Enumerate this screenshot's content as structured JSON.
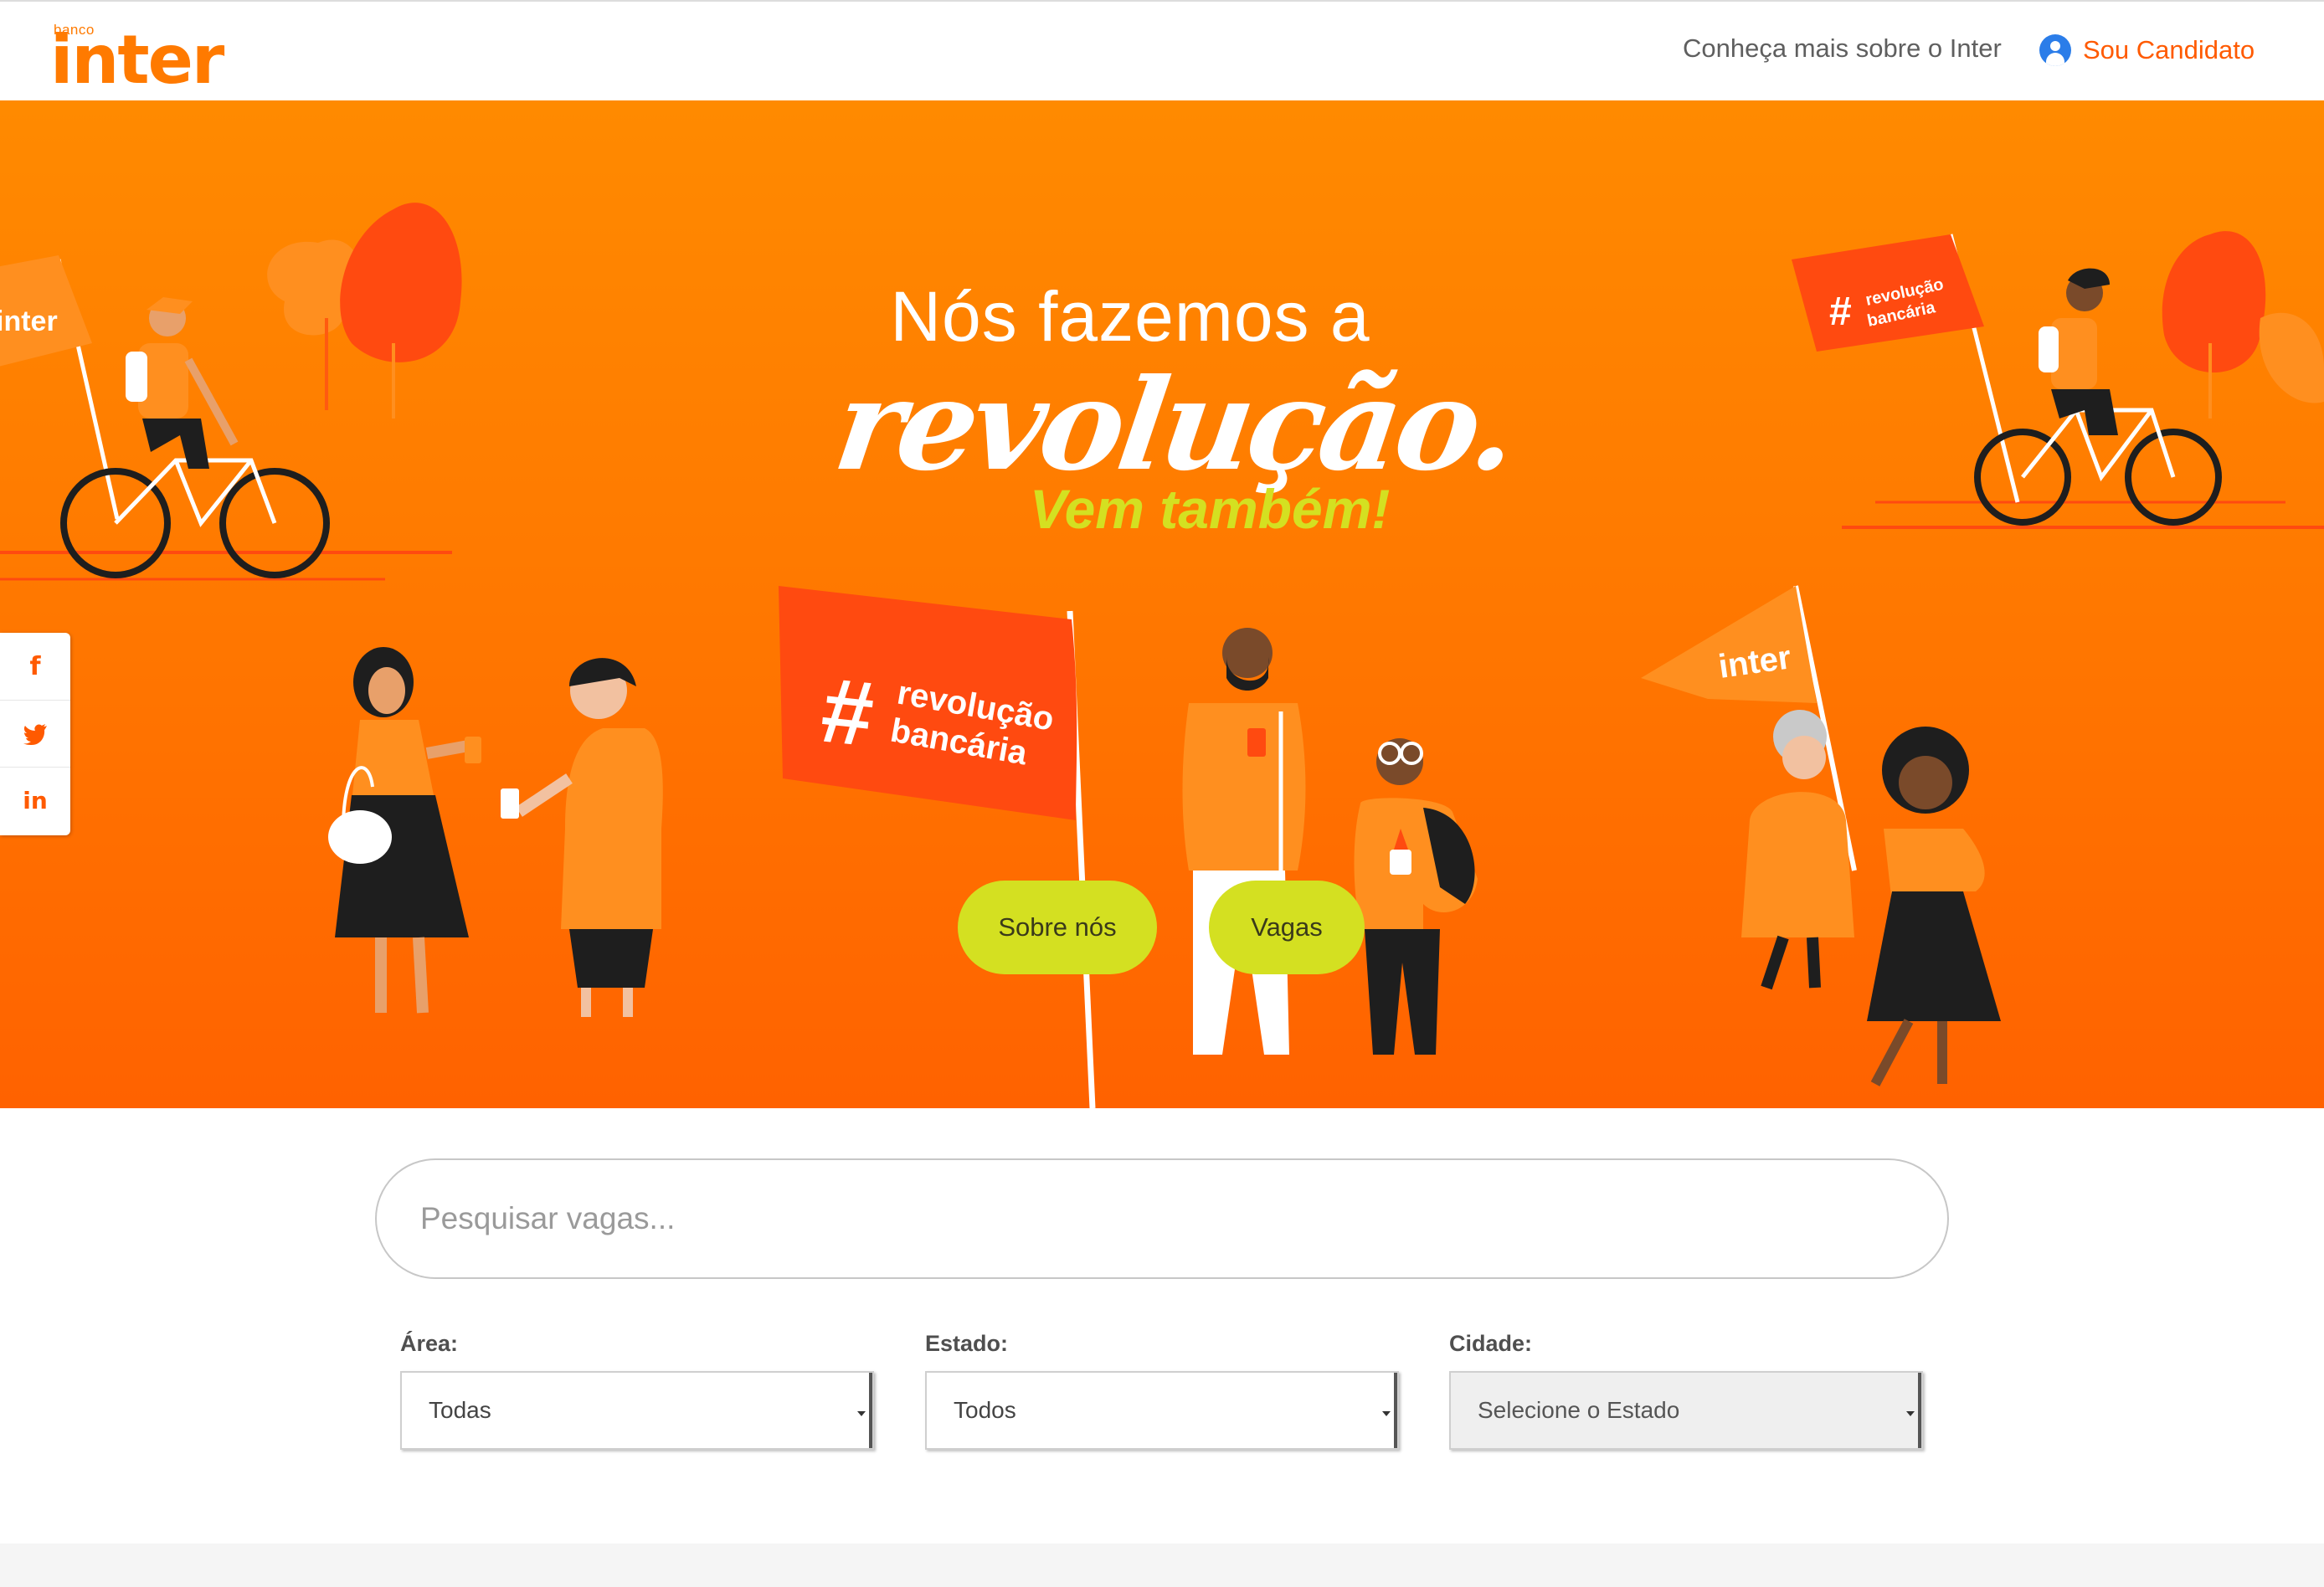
{
  "header": {
    "logo_small": "banco",
    "logo_main": "inter",
    "nav_about": "Conheça mais sobre o Inter",
    "nav_candidate": "Sou Candidato"
  },
  "hero": {
    "headline_line1": "Nós fazemos a",
    "headline_line2": "revolução.",
    "headline_line3": "Vem também!",
    "flag_texts": {
      "left_small_flag": "inter",
      "top_right_flag": "#revolução bancária",
      "center_flag_line1": "revolução",
      "center_flag_line2": "bancária",
      "right_flag": "inter"
    },
    "buttons": {
      "about": "Sobre nós",
      "jobs": "Vagas"
    }
  },
  "social": {
    "items": [
      {
        "label": "f",
        "icon": "facebook-icon"
      },
      {
        "label": "🐦",
        "icon": "twitter-icon"
      },
      {
        "label": "in",
        "icon": "linkedin-icon"
      }
    ]
  },
  "search": {
    "placeholder": "Pesquisar vagas..."
  },
  "filters": {
    "area_label": "Área:",
    "area_value": "Todas",
    "state_label": "Estado:",
    "state_value": "Todos",
    "city_label": "Cidade:",
    "city_value": "Selecione o Estado"
  },
  "colors": {
    "brand_orange": "#ff7a00",
    "accent_lime": "#d4e021",
    "link_orange": "#ff5a00",
    "user_icon_blue": "#2b7de9"
  }
}
